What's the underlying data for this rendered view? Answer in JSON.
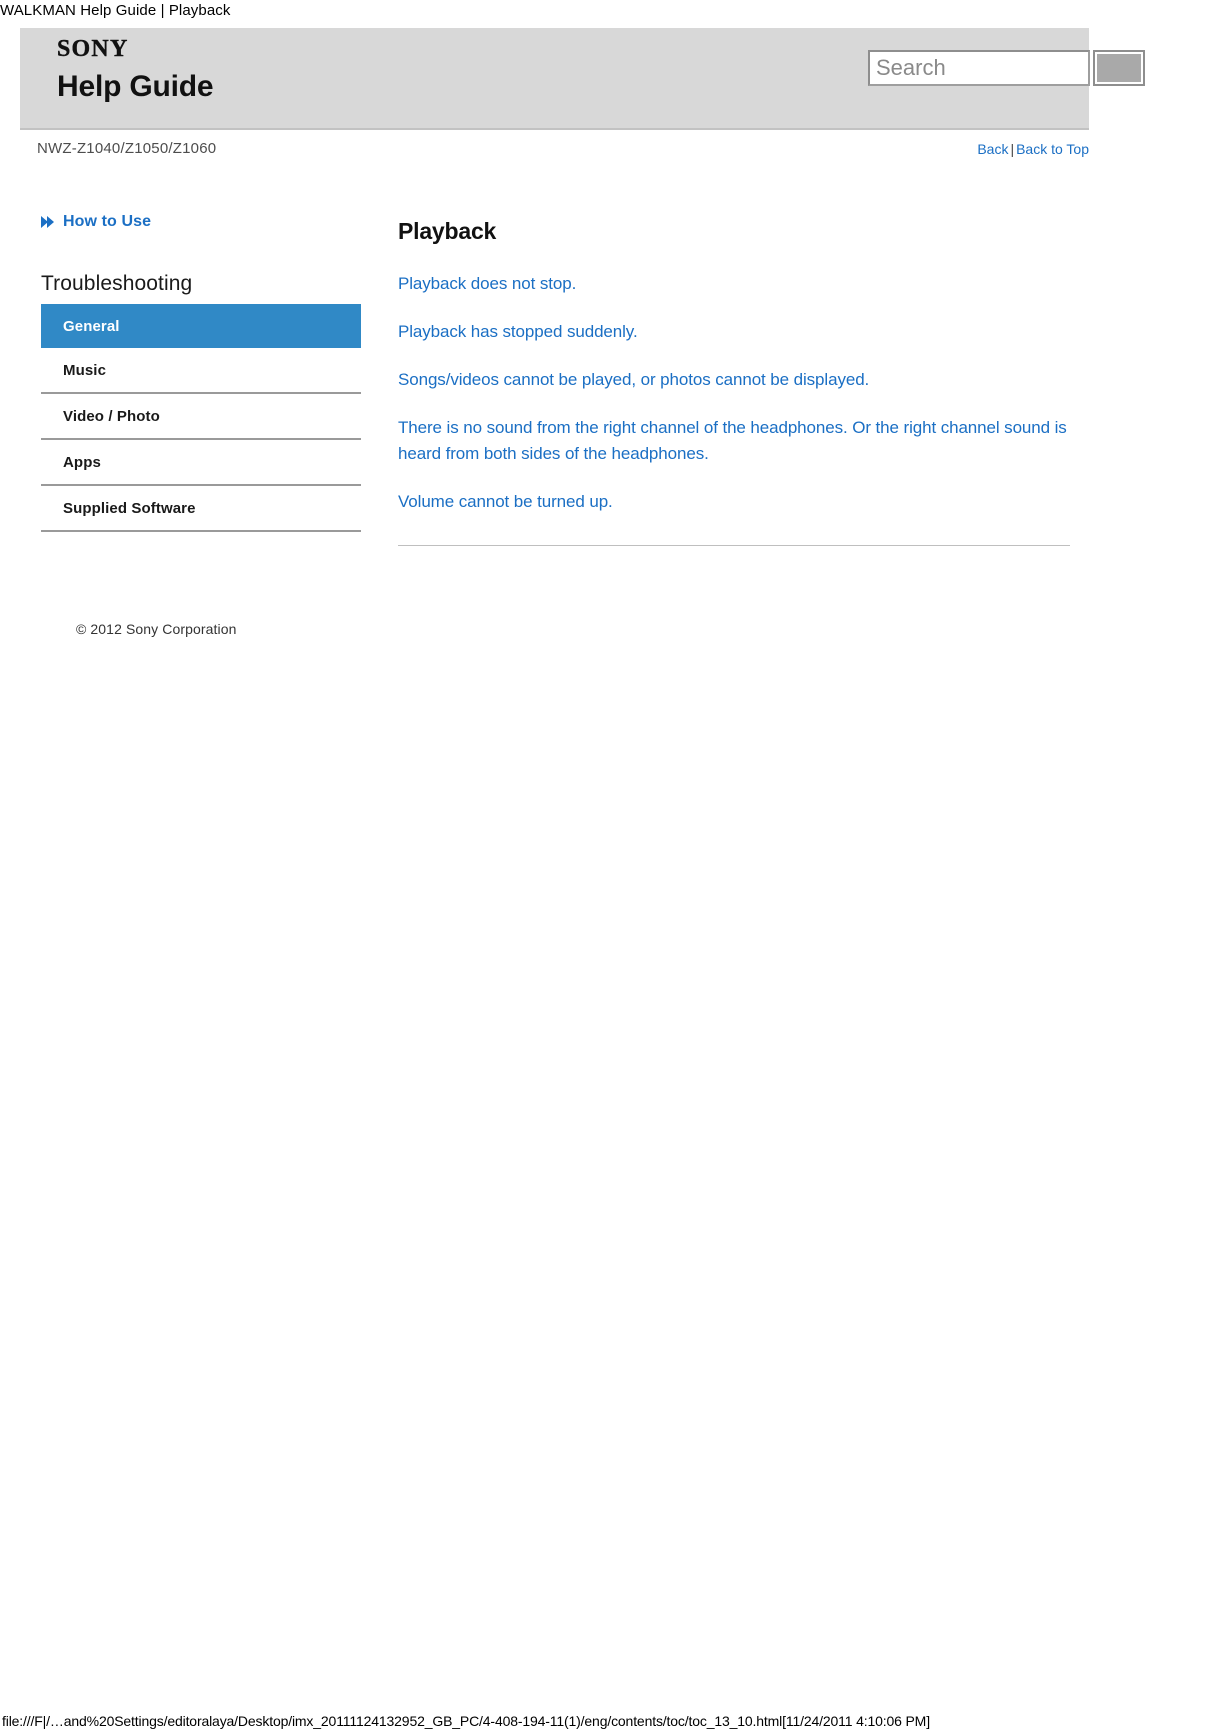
{
  "print_title": "WALKMAN Help Guide | Playback",
  "banner": {
    "brand": "SONY",
    "title": "Help Guide",
    "search": {
      "placeholder": "Search",
      "value": "",
      "button_label": ""
    }
  },
  "model_row": {
    "model": "NWZ-Z1040/Z1050/Z1060",
    "back_label": "Back",
    "separator": "|",
    "back_to_top_label": "Back to Top"
  },
  "sidebar": {
    "how_to_use": {
      "label": "How to Use",
      "icon": "chevron-right-icon"
    },
    "section_heading": "Troubleshooting",
    "items": [
      {
        "label": "General",
        "active": true
      },
      {
        "label": "Music",
        "active": false
      },
      {
        "label": "Video / Photo",
        "active": false
      },
      {
        "label": "Apps",
        "active": false
      },
      {
        "label": "Supplied Software",
        "active": false
      }
    ],
    "copyright": "© 2012 Sony Corporation"
  },
  "main": {
    "heading": "Playback",
    "links": [
      "Playback does not stop.",
      "Playback has stopped suddenly.",
      "Songs/videos cannot be played, or photos cannot be displayed.",
      "There is no sound from the right channel of the headphones. Or the right channel sound is heard from both sides of the headphones.",
      "Volume cannot be turned up."
    ]
  },
  "footer": {
    "url": "file:///F|/…and%20Settings/editoralaya/Desktop/imx_20111124132952_GB_PC/4-408-194-11(1)/eng/contents/toc/toc_13_10.html[11/24/2011 4:10:06 PM]"
  },
  "colors": {
    "accent_blue": "#3089c6",
    "link_blue": "#1b6fc4",
    "banner_gray": "#d8d8d8",
    "rule_gray": "#9a9a9a"
  }
}
